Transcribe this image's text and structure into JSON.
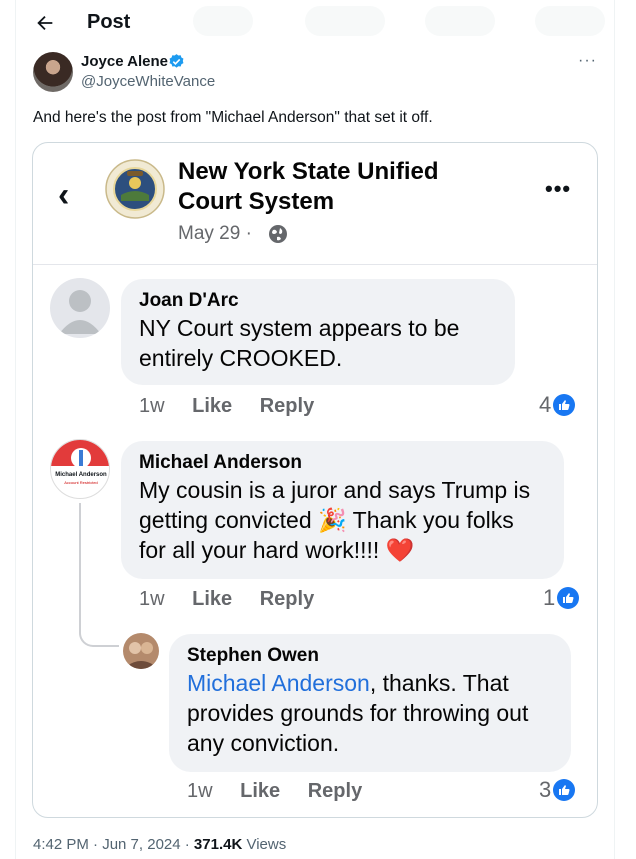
{
  "header": {
    "title": "Post"
  },
  "author": {
    "name": "Joyce Alene",
    "handle": "@JoyceWhiteVance"
  },
  "post": {
    "text": "And here's the post from \"Michael Anderson\" that set it off."
  },
  "embed": {
    "page_name": "New York State Unified Court System",
    "date": "May 29 ·",
    "comments": [
      {
        "name": "Joan D'Arc",
        "text": "NY Court system appears to be entirely CROOKED.",
        "time": "1w",
        "like": "Like",
        "reply": "Reply",
        "reactions": "4"
      },
      {
        "name": "Michael Anderson",
        "text_a": "My cousin is a juror and says Trump is getting convicted",
        "emoji_party": "🎉",
        "text_b": "Thank you folks for all your hard work!!!!",
        "emoji_heart": "❤️",
        "time": "1w",
        "like": "Like",
        "reply": "Reply",
        "reactions": "1",
        "avatar_label": "Michael Anderson",
        "avatar_sub": "Account Restricted"
      },
      {
        "name": "Stephen Owen",
        "mention": "Michael Anderson",
        "text": ", thanks. That provides grounds for throwing out any conviction.",
        "time": "1w",
        "like": "Like",
        "reply": "Reply",
        "reactions": "3"
      }
    ]
  },
  "meta": {
    "time": "4:42 PM · Jun 7, 2024 · ",
    "views": "371.4K",
    "views_label": " Views"
  },
  "colors": {
    "link": "#216fdb",
    "verified": "#1d9bf0",
    "like_blue": "#1877f2"
  },
  "icons": [
    "back-arrow-icon",
    "verified-badge-icon",
    "more-icon",
    "chevron-left-icon",
    "globe-icon",
    "like-thumb-icon"
  ]
}
